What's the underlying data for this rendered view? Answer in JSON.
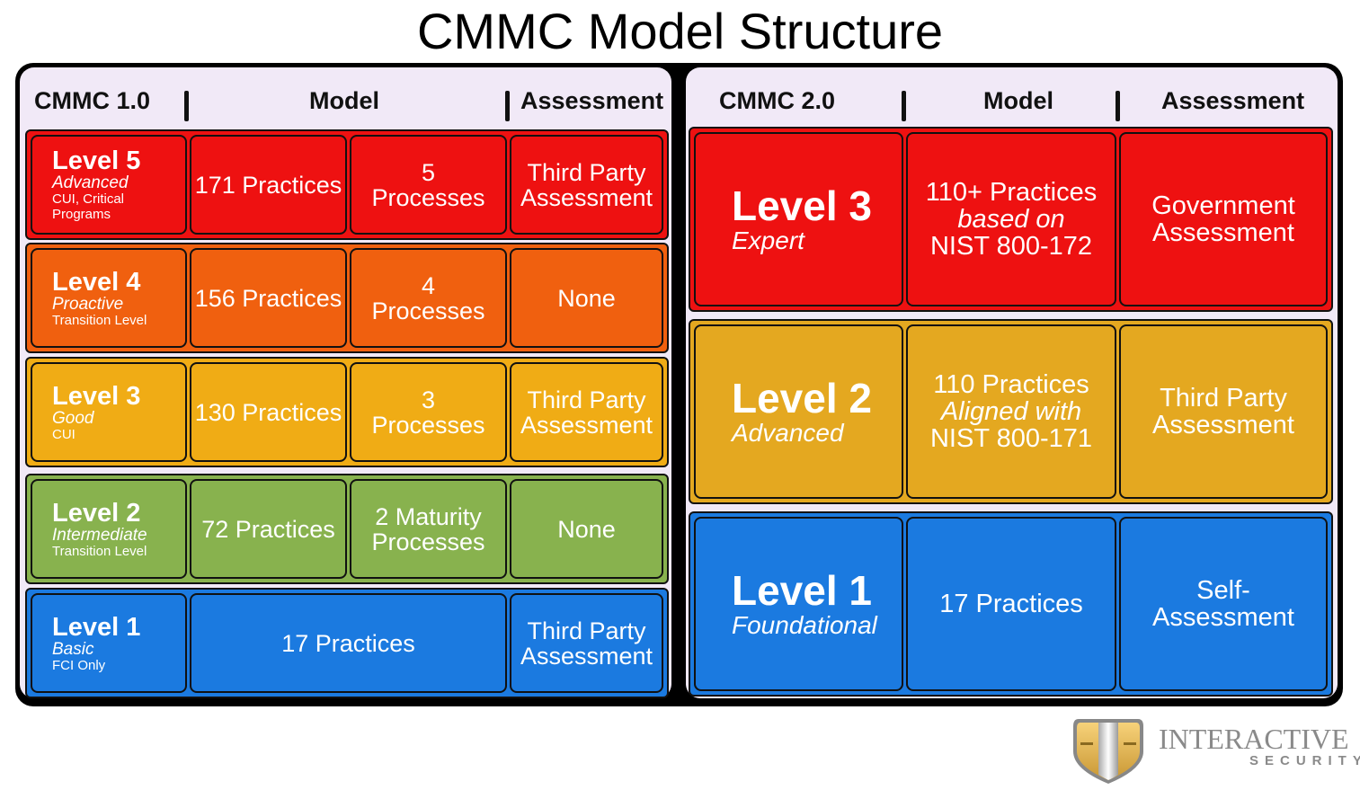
{
  "title": "CMMC Model Structure",
  "colors": {
    "red": "#ee1111",
    "orange": "#f0600f",
    "yellow": "#f0ac15",
    "green": "#88b24e",
    "blue": "#1b7ae0",
    "gold": "#e4a820",
    "panel_bg": "#f1e9f7",
    "frame": "#000000"
  },
  "cmmc1": {
    "header": {
      "version": "CMMC 1.0",
      "model": "Model",
      "assessment": "Assessment"
    },
    "levels": [
      {
        "level": "Level 5",
        "name": "Advanced",
        "desc": "CUI, Critical Programs",
        "practices": "171 Practices",
        "processes": "5 Processes",
        "assessment": "Third Party Assessment"
      },
      {
        "level": "Level 4",
        "name": "Proactive",
        "desc": "Transition Level",
        "practices": "156 Practices",
        "processes": "4 Processes",
        "assessment": "None"
      },
      {
        "level": "Level 3",
        "name": "Good",
        "desc": "CUI",
        "practices": "130 Practices",
        "processes": "3 Processes",
        "assessment": "Third Party Assessment"
      },
      {
        "level": "Level 2",
        "name": "Intermediate",
        "desc": "Transition Level",
        "practices": "72 Practices",
        "processes": "2 Maturity Processes",
        "assessment": "None"
      },
      {
        "level": "Level 1",
        "name": "Basic",
        "desc": "FCI Only",
        "practices": "17 Practices",
        "processes": "",
        "assessment": "Third Party Assessment"
      }
    ]
  },
  "cmmc2": {
    "header": {
      "version": "CMMC 2.0",
      "model": "Model",
      "assessment": "Assessment"
    },
    "levels": [
      {
        "level": "Level 3",
        "name": "Expert",
        "practices": "110+ Practices",
        "practices_note": "based on",
        "practices_ref": "NIST 800-172",
        "assessment": "Government Assessment"
      },
      {
        "level": "Level 2",
        "name": "Advanced",
        "practices": "110 Practices",
        "practices_note": "Aligned with",
        "practices_ref": "NIST 800-171",
        "assessment": "Third Party Assessment"
      },
      {
        "level": "Level 1",
        "name": "Foundational",
        "practices": "17 Practices",
        "practices_note": "",
        "practices_ref": "",
        "assessment": "Self-Assessment"
      }
    ]
  },
  "logo": {
    "brand": "INTERACTIVE",
    "tagline": "SECURITY"
  }
}
